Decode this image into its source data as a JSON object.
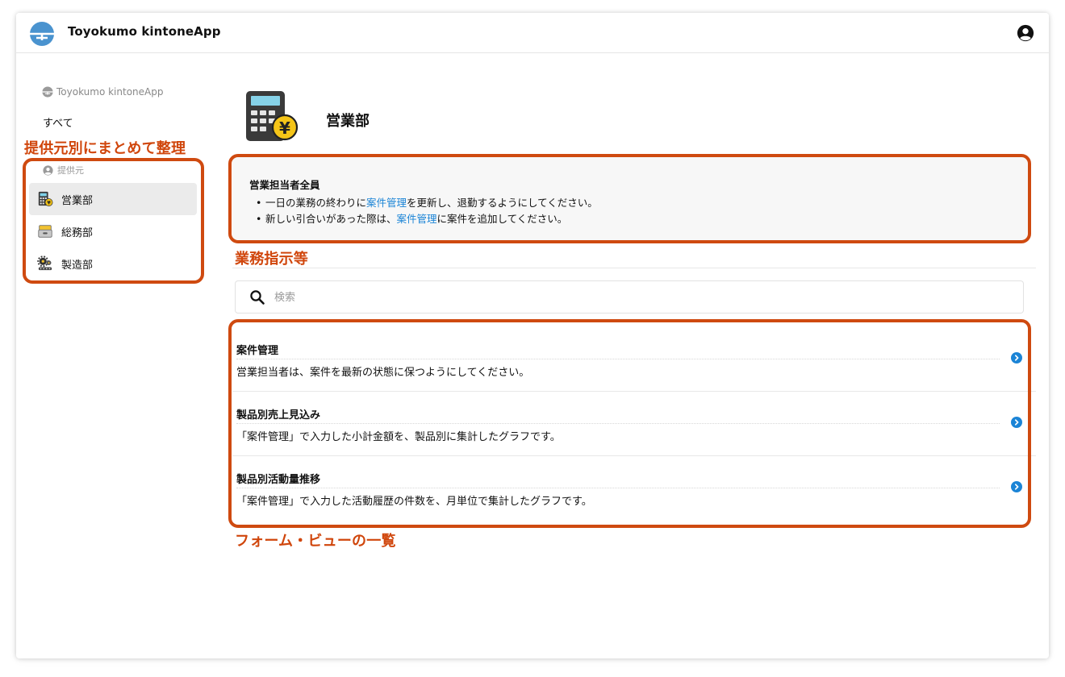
{
  "header": {
    "app_title": "Toyokumo kintoneApp",
    "logo_icon": "toyokumo-logo-icon",
    "account_icon": "account-circle-icon"
  },
  "sidebar": {
    "brand": "Toyokumo kintoneApp",
    "all_label": "すべて",
    "section_label": "提供元",
    "items": [
      {
        "label": "営業部",
        "icon": "calculator-icon",
        "active": true
      },
      {
        "label": "総務部",
        "icon": "drawer-icon",
        "active": false
      },
      {
        "label": "製造部",
        "icon": "gears-icon",
        "active": false
      }
    ]
  },
  "main": {
    "dept_title": "営業部",
    "notice": {
      "heading": "営業担当者全員",
      "line1": {
        "before": "一日の業務の終わりに",
        "link": "案件管理",
        "after": "を更新し、退勤するようにしてください。"
      },
      "line2": {
        "before": "新しい引合いがあった際は、",
        "link": "案件管理",
        "after": "に案件を追加してください。"
      }
    },
    "search": {
      "placeholder": "検索",
      "value": ""
    },
    "items": [
      {
        "title": "案件管理",
        "description": "営業担当者は、案件を最新の状態に保つようにしてください。"
      },
      {
        "title": "製品別売上見込み",
        "description": "「案件管理」で入力した小計金額を、製品別に集計したグラフです。"
      },
      {
        "title": "製品別活動量推移",
        "description": "「案件管理」で入力した活動履歴の件数を、月単位で集計したグラフです。"
      }
    ]
  },
  "annotations": {
    "sidebar_label": "提供元別にまとめて整理",
    "notice_label": "業務指示等",
    "list_label": "フォーム・ビューの一覧",
    "color": "#cf4a10"
  },
  "colors": {
    "link": "#1b84d6",
    "chevron": "#1b84d6",
    "logo": "#3d8fcf"
  }
}
